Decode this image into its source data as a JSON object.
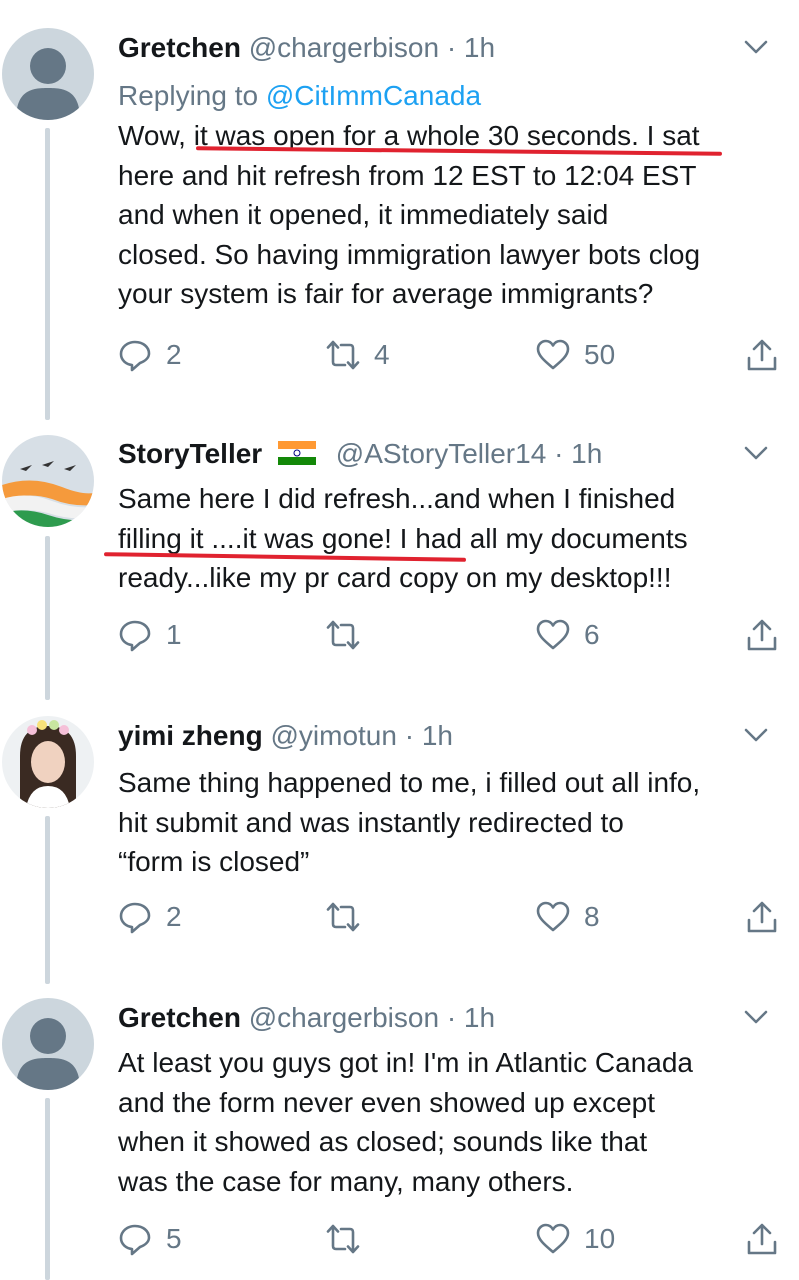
{
  "tweets": [
    {
      "name": "Gretchen",
      "handle": "@chargerbison",
      "time": "· 1h",
      "reply_label": "Replying to",
      "reply_mention": "@CitImmCanada",
      "lines": [
        "Wow, it was open for a whole 30 seconds. I sat",
        "here and hit refresh from 12 EST to 12:04 EST",
        "and when it opened, it immediately said",
        "closed. So having immigration lawyer bots clog",
        "your system is fair for average immigrants?"
      ],
      "replies": "2",
      "retweets": "4",
      "likes": "50"
    },
    {
      "name": "StoryTeller",
      "handle": "@AStoryTeller14",
      "time": "· 1h",
      "lines": [
        "Same here I did refresh...and when I finished",
        "filling it ....it was gone! I had all my documents",
        "ready...like my pr card copy on my desktop!!!"
      ],
      "replies": "1",
      "retweets": "",
      "likes": "6"
    },
    {
      "name": "yimi zheng",
      "handle": "@yimotun",
      "time": "· 1h",
      "lines": [
        "Same thing happened to me, i filled out all info,",
        "hit submit and was instantly redirected to",
        "“form is closed”"
      ],
      "replies": "2",
      "retweets": "",
      "likes": "8"
    },
    {
      "name": "Gretchen",
      "handle": "@chargerbison",
      "time": "· 1h",
      "lines": [
        "At least you guys got in! I'm in Atlantic Canada",
        "and the form never even showed up except",
        "when it showed as closed; sounds like that",
        "was the case for many, many others."
      ],
      "replies": "5",
      "retweets": "",
      "likes": "10"
    }
  ],
  "icons": {
    "reply": "reply-icon",
    "retweet": "retweet-icon",
    "like": "heart-icon",
    "share": "share-icon",
    "more": "chevron-down-icon",
    "flag": "india-flag-icon"
  },
  "colors": {
    "text": "#14171a",
    "secondary": "#657786",
    "link": "#1da1f2",
    "thread_line": "#cdd6dd",
    "annotation": "#e0222f"
  }
}
